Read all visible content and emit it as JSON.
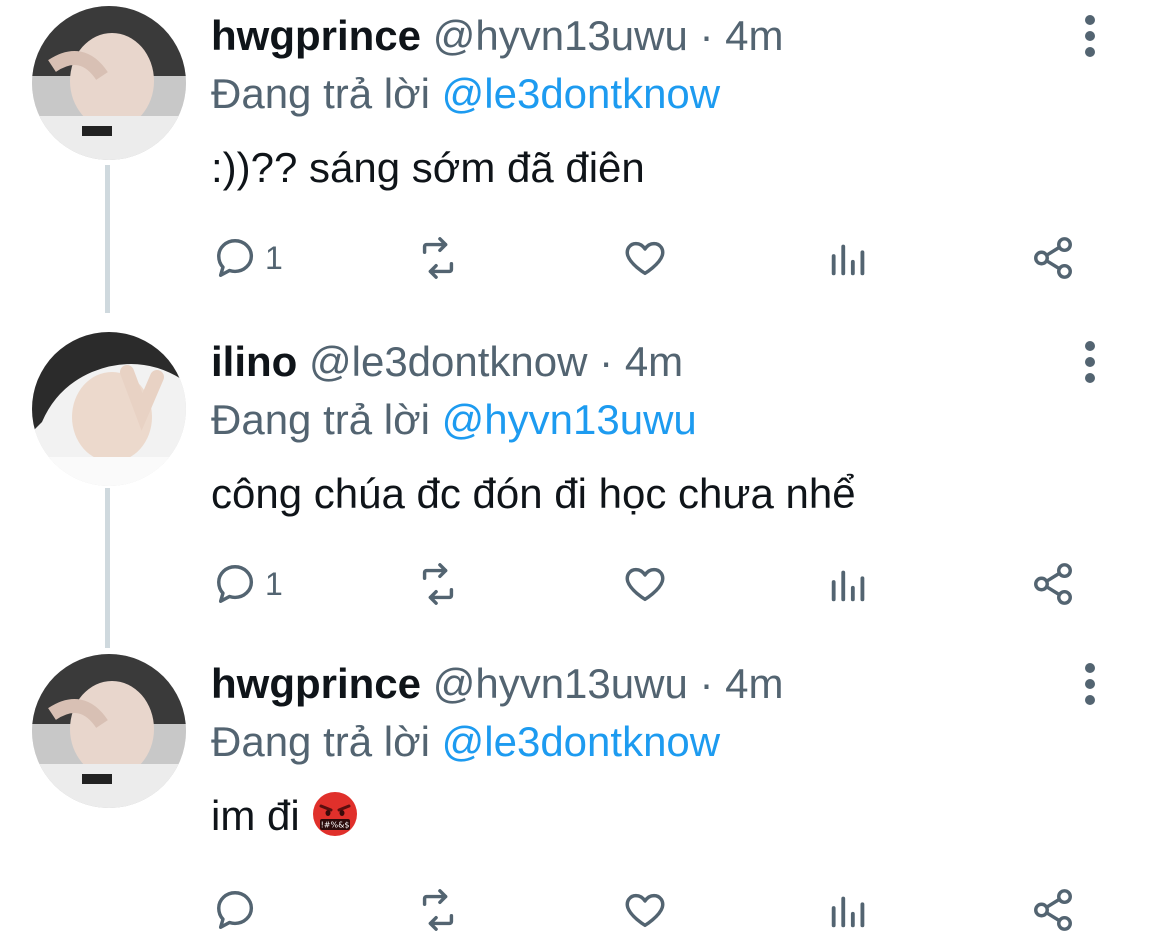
{
  "icons": {
    "reply": "reply-icon",
    "retweet": "retweet-icon",
    "like": "heart-icon",
    "views": "analytics-icon",
    "share": "share-icon",
    "more": "more-vertical-icon"
  },
  "colors": {
    "mention": "#1d9bf0",
    "secondary": "#536471",
    "thread_line": "#cfd9de"
  },
  "tweets": [
    {
      "name": "hwgprince",
      "handle": "@hyvn13uwu",
      "dot": "·",
      "time": "4m",
      "replying_prefix": "Đang trả lời",
      "replying_to": "@le3dontknow",
      "text": ":))?? sáng sớm đã điên",
      "reply_count": "1"
    },
    {
      "name": "ilino",
      "handle": "@le3dontknow",
      "dot": "·",
      "time": "4m",
      "replying_prefix": "Đang trả lời",
      "replying_to": "@hyvn13uwu",
      "text": "công chúa đc đón đi học chưa nhể",
      "reply_count": "1"
    },
    {
      "name": "hwgprince",
      "handle": "@hyvn13uwu",
      "dot": "·",
      "time": "4m",
      "replying_prefix": "Đang trả lời",
      "replying_to": "@le3dontknow",
      "text": "im đi",
      "emoji": "face-with-symbols-on-mouth-emoji",
      "emoji_text": "!#%&$",
      "reply_count": ""
    }
  ]
}
